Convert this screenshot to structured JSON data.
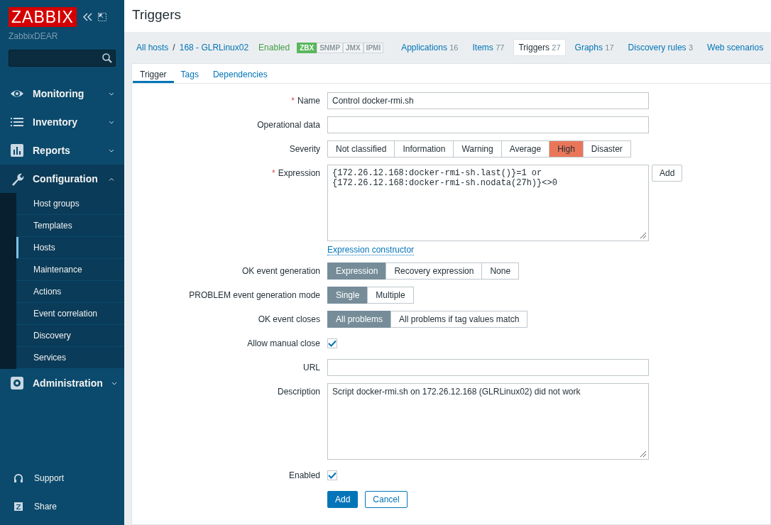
{
  "sidebar": {
    "logo": "ZABBIX",
    "server": "ZabbixDEAR",
    "menu": [
      {
        "label": "Monitoring",
        "expanded": false
      },
      {
        "label": "Inventory",
        "expanded": false
      },
      {
        "label": "Reports",
        "expanded": false
      },
      {
        "label": "Configuration",
        "expanded": true,
        "children": [
          {
            "label": "Host groups",
            "selected": false
          },
          {
            "label": "Templates",
            "selected": false
          },
          {
            "label": "Hosts",
            "selected": true
          },
          {
            "label": "Maintenance",
            "selected": false
          },
          {
            "label": "Actions",
            "selected": false
          },
          {
            "label": "Event correlation",
            "selected": false
          },
          {
            "label": "Discovery",
            "selected": false
          },
          {
            "label": "Services",
            "selected": false
          }
        ]
      },
      {
        "label": "Administration",
        "expanded": false
      }
    ],
    "footer": [
      {
        "label": "Support"
      },
      {
        "label": "Share"
      }
    ]
  },
  "page_title": "Triggers",
  "breadcrumb": {
    "items": [
      "All hosts",
      "168 - GLRLinux02"
    ],
    "separator": "/"
  },
  "host_status": "Enabled",
  "interfaces": [
    {
      "label": "ZBX",
      "available": true
    },
    {
      "label": "SNMP",
      "available": false
    },
    {
      "label": "JMX",
      "available": false
    },
    {
      "label": "IPMI",
      "available": false
    }
  ],
  "host_tabs": [
    {
      "label": "Applications",
      "count": "16",
      "selected": false
    },
    {
      "label": "Items",
      "count": "77",
      "selected": false
    },
    {
      "label": "Triggers",
      "count": "27",
      "selected": true
    },
    {
      "label": "Graphs",
      "count": "17",
      "selected": false
    },
    {
      "label": "Discovery rules",
      "count": "3",
      "selected": false
    },
    {
      "label": "Web scenarios",
      "selected": false
    }
  ],
  "form_tabs": [
    {
      "label": "Trigger",
      "selected": true
    },
    {
      "label": "Tags",
      "selected": false
    },
    {
      "label": "Dependencies",
      "selected": false
    }
  ],
  "fields": [
    {
      "kind": "text",
      "label": "Name",
      "required_mark": "*",
      "value": "Control docker-rmi.sh"
    },
    {
      "kind": "text",
      "label": "Operational data"
    },
    {
      "kind": "segmented",
      "label": "Severity",
      "options": [
        {
          "label": "Not classified",
          "selected": false
        },
        {
          "label": "Information",
          "selected": false
        },
        {
          "label": "Warning",
          "selected": false
        },
        {
          "label": "Average",
          "selected": false
        },
        {
          "label": "High",
          "selected": true
        },
        {
          "label": "Disaster",
          "selected": false
        }
      ]
    },
    {
      "kind": "expression",
      "label": "Expression",
      "required_mark": "*",
      "value": "{172.26.12.168:docker-rmi-sh.last()}=1 or\n{172.26.12.168:docker-rmi-sh.nodata(27h)}<>0",
      "button": "Add",
      "link": "Expression constructor"
    },
    {
      "kind": "segmented",
      "label": "OK event generation",
      "options": [
        {
          "label": "Expression",
          "selected": true
        },
        {
          "label": "Recovery expression",
          "selected": false
        },
        {
          "label": "None",
          "selected": false
        }
      ]
    },
    {
      "kind": "segmented",
      "label": "PROBLEM event generation mode",
      "options": [
        {
          "label": "Single",
          "selected": true
        },
        {
          "label": "Multiple",
          "selected": false
        }
      ]
    },
    {
      "kind": "segmented",
      "label": "OK event closes",
      "options": [
        {
          "label": "All problems",
          "selected": true
        },
        {
          "label": "All problems if tag values match",
          "selected": false
        }
      ]
    },
    {
      "kind": "checkbox",
      "label": "Allow manual close",
      "checked": true
    },
    {
      "kind": "text",
      "label": "URL"
    },
    {
      "kind": "textarea",
      "label": "Description",
      "value": "Script docker-rmi.sh on 172.26.12.168 (GLRLinux02) did not work"
    },
    {
      "kind": "checkbox",
      "label": "Enabled",
      "checked": true
    }
  ],
  "buttons": [
    {
      "label": "Add",
      "primary": true
    },
    {
      "label": "Cancel",
      "primary": false
    }
  ]
}
